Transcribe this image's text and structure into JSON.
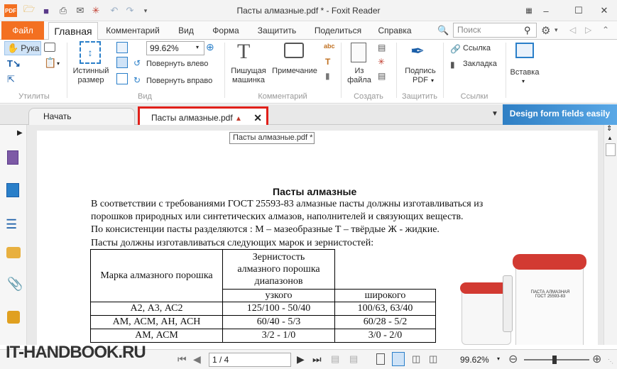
{
  "window": {
    "title": "Пасты алмазные.pdf * - Foxit Reader"
  },
  "quick_access": {
    "pdf_badge": "PDF"
  },
  "ribbon_tabs": {
    "file": "Файл",
    "home": "Главная",
    "tabs": [
      "Комментарий",
      "Вид",
      "Форма",
      "Защитить",
      "Поделиться",
      "Справка"
    ]
  },
  "search": {
    "placeholder": "Поиск"
  },
  "ribbon": {
    "hand": "Рука",
    "actual_size_1": "Истинный",
    "actual_size_2": "размер",
    "zoom_value": "99.62%",
    "rotate_left": "Повернуть влево",
    "rotate_right": "Повернуть вправо",
    "typewriter_1": "Пишущая",
    "typewriter_2": "машинка",
    "note": "Примечание",
    "from_file_1": "Из",
    "from_file_2": "файла",
    "sign_1": "Подпись",
    "sign_2": "PDF",
    "link": "Ссылка",
    "bookmark": "Закладка",
    "insert": "Вставка",
    "groups": {
      "utilities": "Утилиты",
      "view": "Вид",
      "comment": "Комментарий",
      "create": "Создать",
      "protect": "Защитить",
      "links": "Ссылки"
    }
  },
  "doc_tabs": {
    "start": "Начать",
    "active": "Пасты алмазные.pdf",
    "banner": "Design form fields easily"
  },
  "tooltip": "Пасты алмазные.pdf *",
  "document": {
    "heading": "Пасты алмазные",
    "paragraphs": [
      "В соответствии с требованиями ГОСТ 25593-83 алмазные пасты должны изготавливаться из",
      "порошков природных или синтетических алмазов, наполнителей и связующих веществ.",
      "По консистенции пасты разделяются :  М – мазеобразные   Т – твёрдые   Ж - жидкие.",
      "Пасты должны изготавливаться следующих марок и зернистостей:"
    ],
    "table": {
      "col1_header": "Марка алмазного порошка",
      "group_header": [
        "Зернистость",
        "алмазного порошка",
        "диапазонов"
      ],
      "sub_headers": [
        "узкого",
        "широкого"
      ],
      "rows": [
        [
          "А2, А3, АС2",
          "125/100 - 50/40",
          "100/63, 63/40"
        ],
        [
          "АМ, АСМ, АН, АСН",
          "60/40 - 5/3",
          "60/28 - 5/2"
        ],
        [
          "АМ, АСМ",
          "3/2 - 1/0",
          "3/0 - 2/0"
        ]
      ]
    },
    "jar_label_1": "ПАСТА АЛМАЗНАЯ",
    "jar_label_2": "ГОСТ 25593-83"
  },
  "status": {
    "page": "1 / 4",
    "zoom": "99.62%"
  },
  "watermark": "IT-HANDBOOK.RU",
  "colors": {
    "accent": "#f37021",
    "highlight": "#e0201a",
    "banner": "#3d8fd1"
  }
}
